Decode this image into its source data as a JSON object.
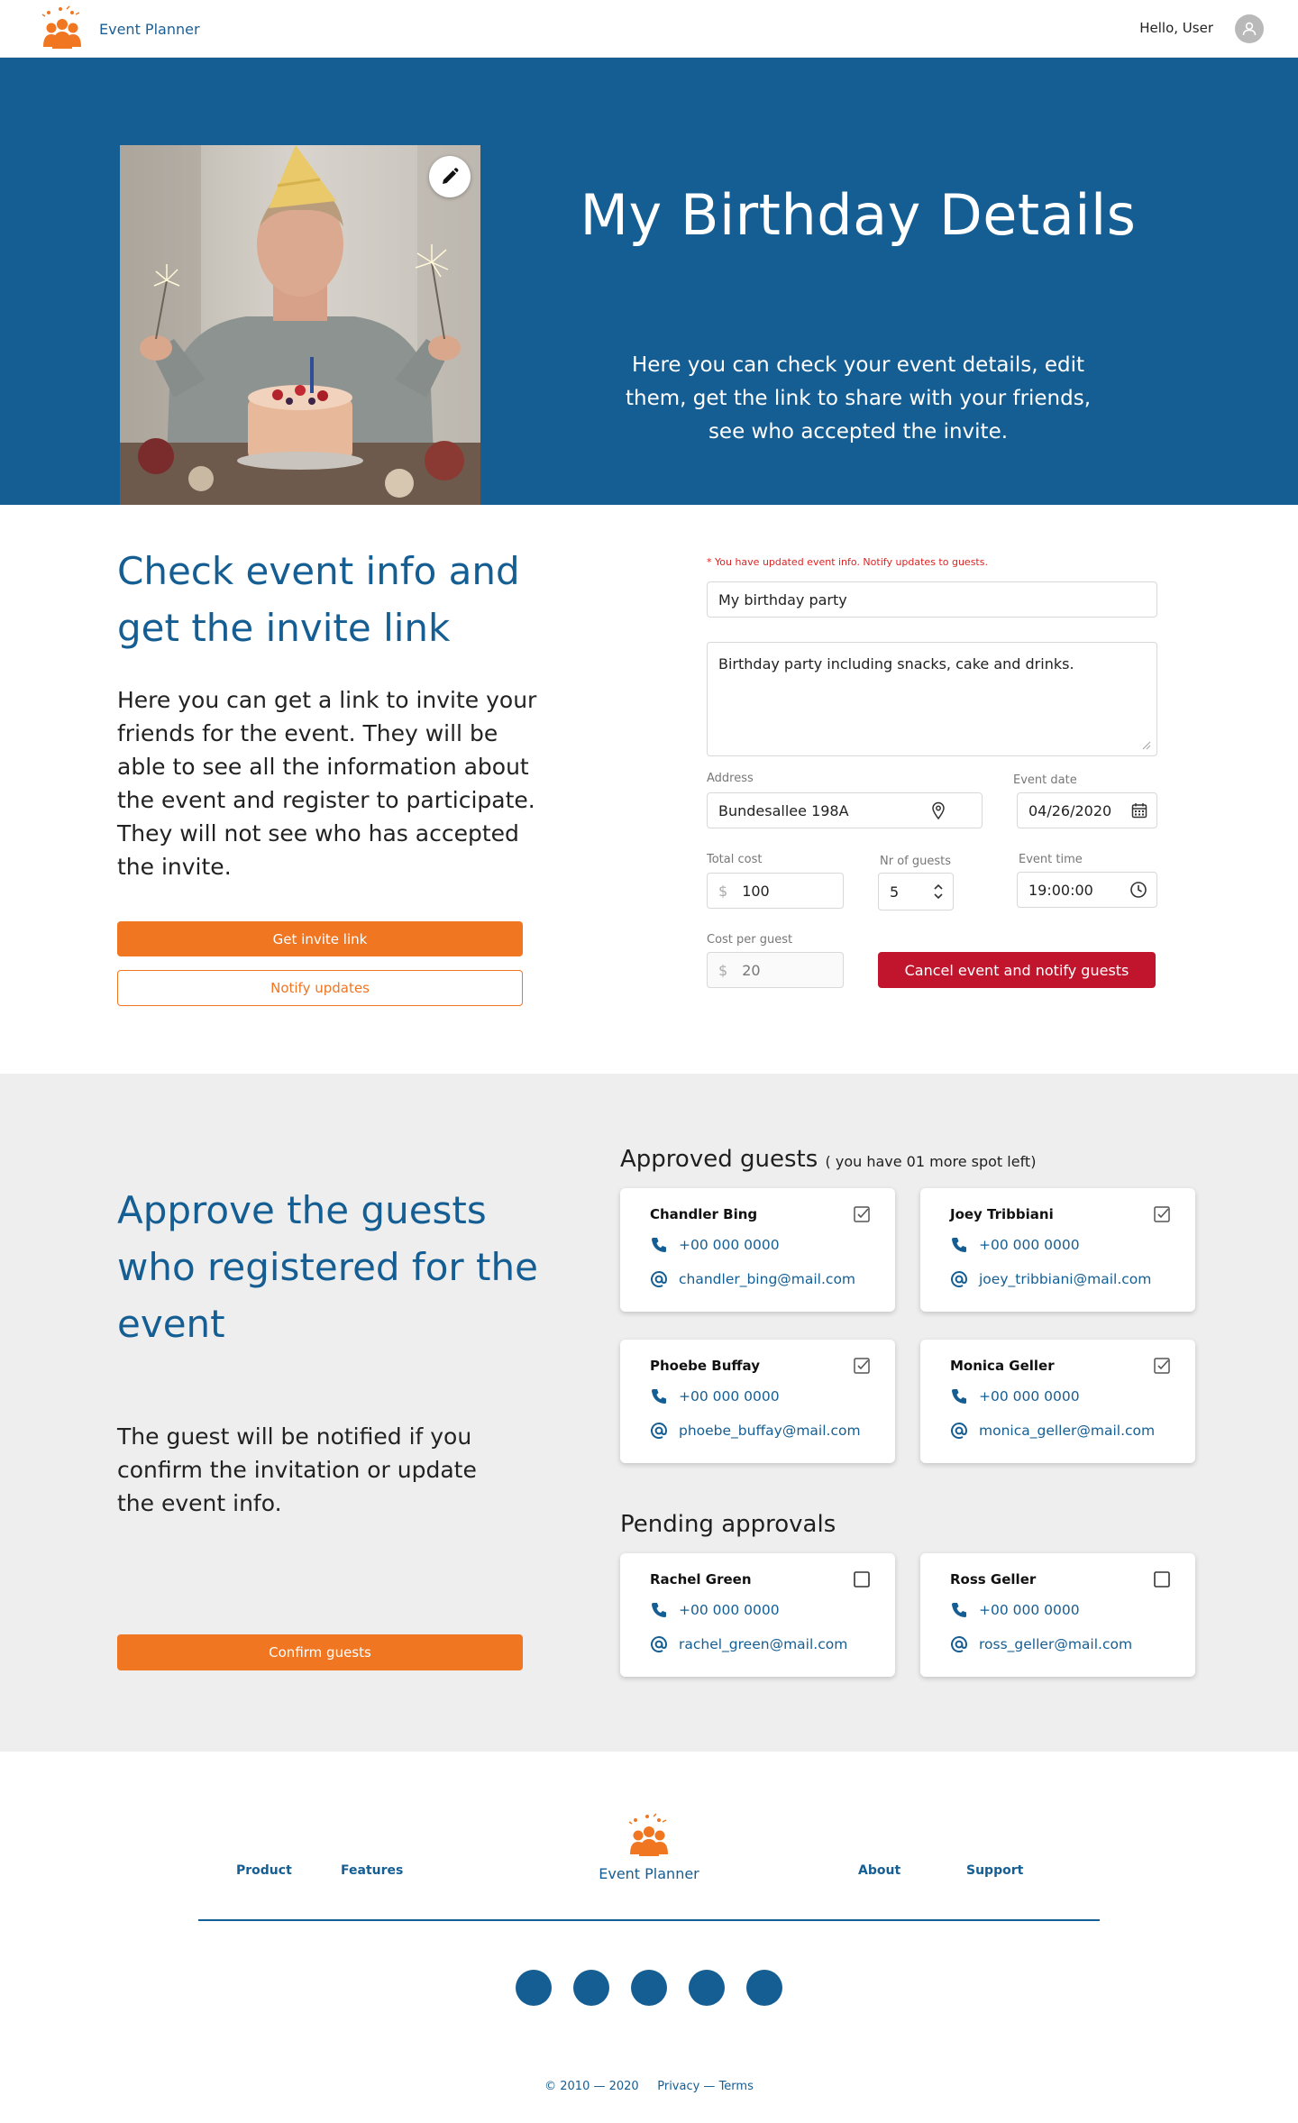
{
  "header": {
    "brand": "Event Planner",
    "greeting": "Hello, User"
  },
  "hero": {
    "title": "My Birthday Details",
    "subtitle": "Here you can check your event details, edit them, get the link to share with your friends, see who accepted the invite."
  },
  "event_info": {
    "heading": "Check event info and get the invite link",
    "description": "Here you can get a link to invite your friends for the event. They will be able to see all the information about the event and register to participate. They will not see who has accepted the invite.",
    "get_link_button": "Get invite link",
    "notify_button": "Notify updates",
    "update_notice": "* You have updated event info. Notify updates to guests.",
    "form": {
      "title_value": "My birthday party",
      "description_value": "Birthday party including snacks, cake and drinks.",
      "address_label": "Address",
      "address_value": "Bundesallee 198A",
      "date_label": "Event date",
      "date_value": "04/26/2020",
      "total_cost_label": "Total cost",
      "currency": "$",
      "total_cost_value": "100",
      "guests_label": "Nr of guests",
      "guests_value": "5",
      "time_label": "Event time",
      "time_value": "19:00:00",
      "cost_per_guest_label": "Cost per guest",
      "cost_per_guest_value": "20",
      "cancel_button": "Cancel event and notify guests"
    }
  },
  "guests": {
    "heading": "Approve the guests who registered for the event",
    "description": "The guest will be notified if you confirm the invitation or update the event info.",
    "confirm_button": "Confirm guests",
    "approved_title": "Approved guests",
    "approved_note": "( you have 01 more spot left)",
    "pending_title": "Pending approvals",
    "approved": [
      {
        "name": "Chandler Bing",
        "phone": "+00 000 0000",
        "email": "chandler_bing@mail.com",
        "checked": true
      },
      {
        "name": "Joey Tribbiani",
        "phone": "+00 000 0000",
        "email": "joey_tribbiani@mail.com",
        "checked": true
      },
      {
        "name": "Phoebe Buffay",
        "phone": "+00 000 0000",
        "email": "phoebe_buffay@mail.com",
        "checked": true
      },
      {
        "name": "Monica Geller",
        "phone": "+00 000 0000",
        "email": "monica_geller@mail.com",
        "checked": true
      }
    ],
    "pending": [
      {
        "name": "Rachel Green",
        "phone": "+00 000 0000",
        "email": "rachel_green@mail.com",
        "checked": false
      },
      {
        "name": "Ross Geller",
        "phone": "+00 000 0000",
        "email": "ross_geller@mail.com",
        "checked": false
      }
    ]
  },
  "footer": {
    "links": [
      "Product",
      "Features",
      "About",
      "Support"
    ],
    "brand": "Event Planner",
    "copyright": "© 2010 — 2020",
    "privacy": "Privacy — Terms"
  },
  "colors": {
    "primary": "#155e93",
    "accent": "#f07622",
    "danger": "#c1152e",
    "section_bg": "#eeeeee"
  }
}
